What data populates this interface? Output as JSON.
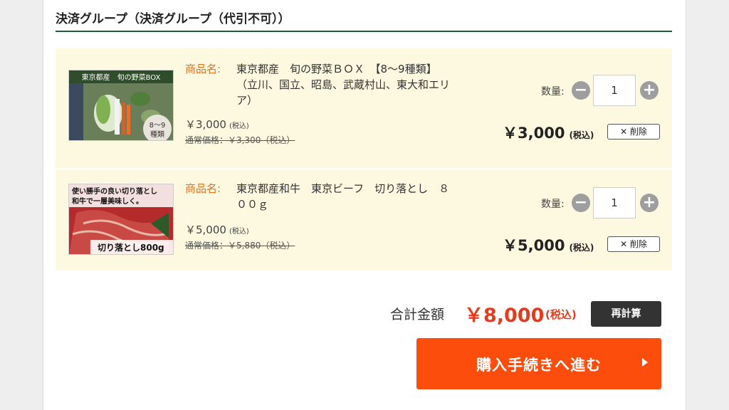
{
  "group": {
    "title": "決済グループ（決済グループ（代引不可））"
  },
  "items": [
    {
      "label": "商品名:",
      "name": "東京都産　旬の野菜ＢＯＸ　【8〜9種類】　（立川、国立、昭島、武蔵村山、東大和エリア）",
      "price": "￥3,000",
      "price_tax": "(税込)",
      "regular_price": "通常価格：￥3,300（税込）",
      "qty_label": "数量:",
      "quantity": "1",
      "subtotal": "￥3,000",
      "subtotal_tax": "(税込)",
      "delete_label": "✕ 削除",
      "image_text": [
        "東京都産　旬の野菜BOX",
        "8〜9",
        "種類"
      ]
    },
    {
      "label": "商品名:",
      "name": "東京都産和牛　東京ビーフ　切り落とし　８００ｇ",
      "price": "￥5,000",
      "price_tax": "(税込)",
      "regular_price": "通常価格：￥5,880（税込）",
      "qty_label": "数量:",
      "quantity": "1",
      "subtotal": "￥5,000",
      "subtotal_tax": "(税込)",
      "delete_label": "✕ 削除",
      "image_text": [
        "使い勝手の良い切り落とし",
        "和牛で一層美味しく。",
        "切り落とし800g"
      ]
    }
  ],
  "summary": {
    "total_label": "合計金額",
    "total_value": "￥8,000",
    "total_tax": "(税込)",
    "recalc_label": "再計算",
    "checkout_label": "購入手続きへ進む"
  },
  "colors": {
    "accent": "#fd4d0c",
    "total": "#e53a1b",
    "label": "#e8701b",
    "cart_bg": "#fdf8e0",
    "heading_rule": "#1f5c3a"
  },
  "icons": {
    "minus": "minus-icon",
    "plus": "plus-icon",
    "arrow": "arrow-right-icon"
  }
}
